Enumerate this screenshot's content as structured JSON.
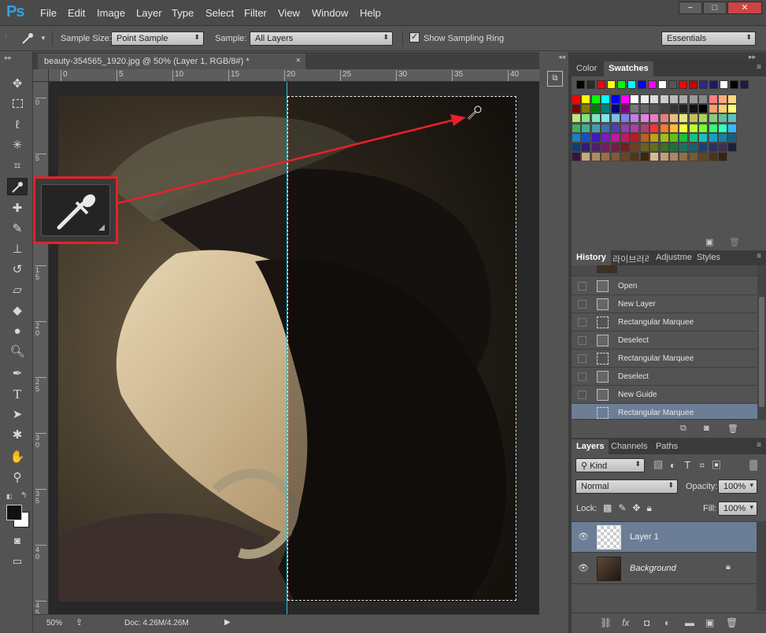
{
  "app": {
    "logo": "Ps"
  },
  "menu": [
    "File",
    "Edit",
    "Image",
    "Layer",
    "Type",
    "Select",
    "Filter",
    "View",
    "Window",
    "Help"
  ],
  "window_controls": {
    "minimize": "−",
    "restore": "□",
    "close": "✕"
  },
  "options": {
    "sample_size_label": "Sample Size:",
    "sample_size_value": "Point Sample",
    "sample_label": "Sample:",
    "sample_value": "All Layers",
    "show_sampling_ring": "Show Sampling Ring",
    "workspace": "Essentials"
  },
  "document": {
    "tab_title": "beauty-354565_1920.jpg @ 50% (Layer 1, RGB/8#) *",
    "close": "×",
    "zoom": "50%",
    "doc_info": "Doc: 4.26M/4.26M"
  },
  "rulers": {
    "top": [
      "0",
      "5",
      "10",
      "15",
      "20",
      "25",
      "30",
      "35",
      "40"
    ],
    "left": [
      "0",
      "5",
      "1\n0",
      "1\n5",
      "2\n0",
      "2\n5",
      "3\n0",
      "3\n5",
      "4\n0",
      "4\n5"
    ]
  },
  "color_panel": {
    "tabs": [
      "Color",
      "Swatches"
    ],
    "active": "Swatches"
  },
  "swatches": {
    "row1": [
      "#000000",
      "#2b2b2b",
      "#ff0000",
      "#ffff00",
      "#00ff00",
      "#00ffff",
      "#0000ff",
      "#ff00ff",
      "#ffffff",
      "#555555",
      "#ff0000",
      "#cc0000",
      "#2b2b80",
      "#1a1a6b",
      "#ffffff",
      "#000000",
      "#1a1a4d"
    ],
    "grid": [
      [
        "#ff0000",
        "#ffff00",
        "#00ff00",
        "#00ffff",
        "#0000ff",
        "#ff00ff",
        "#ffffff",
        "#eeeeee",
        "#dddddd",
        "#cccccc",
        "#bbbbbb",
        "#aaaaaa",
        "#999999",
        "#888888",
        "#ff7f7f",
        "#ffaa7f",
        "#ffd47f"
      ],
      [
        "#7f0000",
        "#7f7f00",
        "#007f00",
        "#007f7f",
        "#00007f",
        "#7f007f",
        "#777777",
        "#666666",
        "#555555",
        "#444444",
        "#333333",
        "#222222",
        "#111111",
        "#000000",
        "#ff9f6f",
        "#ffcf6f",
        "#ffff6f"
      ],
      [
        "#bfe57f",
        "#7fe57f",
        "#7fe5bf",
        "#7fe5e5",
        "#7fbfe5",
        "#7f7fe5",
        "#bf7fe5",
        "#e57fe5",
        "#e57fbf",
        "#e57f7f",
        "#e5bf7f",
        "#e5e57f",
        "#bfbf60",
        "#a5d65a",
        "#7fcf7f",
        "#60bf9f",
        "#5fbfbf"
      ],
      [
        "#3fae5f",
        "#3fae8f",
        "#3f9fae",
        "#3f6fae",
        "#4f3fae",
        "#8f3fae",
        "#ae3f9f",
        "#ae3f6f",
        "#ff3333",
        "#ff7733",
        "#ffbb33",
        "#ffff33",
        "#bbff33",
        "#77ff33",
        "#33ff77",
        "#33ffbb",
        "#33bbff"
      ],
      [
        "#1a7fbf",
        "#1a4fbf",
        "#3f1abf",
        "#7f1abf",
        "#bf1a9f",
        "#bf1a5f",
        "#bf1a1a",
        "#bf5f1a",
        "#bf9f1a",
        "#9fbf1a",
        "#5fbf1a",
        "#1abf3f",
        "#1abf7f",
        "#1abfbf",
        "#1a9fbf",
        "#1a7f9f",
        "#1a5f7f"
      ],
      [
        "#0f3f6f",
        "#2f1f6f",
        "#4f1f6f",
        "#6f1f5f",
        "#6f1f3f",
        "#6f1f1f",
        "#6f3f1f",
        "#6f5f1f",
        "#5f6f1f",
        "#3f6f1f",
        "#1f6f3f",
        "#1f6f5f",
        "#1f5f6f",
        "#1f3f6f",
        "#2f2f5f",
        "#3f2f4f",
        "#1f1f3f"
      ],
      [
        "#3f0f3f",
        "#c8a882",
        "#b08860",
        "#987048",
        "#805a34",
        "#6a4624",
        "#563418",
        "#3f240f",
        "#d8b890",
        "#c0a078",
        "#a88860",
        "#907048",
        "#785a34",
        "#604424",
        "#4a3418",
        "#34240f"
      ]
    ]
  },
  "history_panel": {
    "tabs": [
      "History",
      "라이브러리",
      "Adjustme",
      "Styles"
    ],
    "items": [
      {
        "label": "Open",
        "icon": "doc"
      },
      {
        "label": "New Layer",
        "icon": "doc"
      },
      {
        "label": "Rectangular Marquee",
        "icon": "marquee"
      },
      {
        "label": "Deselect",
        "icon": "doc"
      },
      {
        "label": "Rectangular Marquee",
        "icon": "marquee"
      },
      {
        "label": "Deselect",
        "icon": "doc"
      },
      {
        "label": "New Guide",
        "icon": "doc"
      },
      {
        "label": "Rectangular Marquee",
        "icon": "marquee",
        "selected": true
      }
    ]
  },
  "layers_panel": {
    "tabs": [
      "Layers",
      "Channels",
      "Paths"
    ],
    "kind": "Kind",
    "blend_mode": "Normal",
    "opacity_label": "Opacity:",
    "opacity_value": "100%",
    "lock_label": "Lock:",
    "fill_label": "Fill:",
    "fill_value": "100%",
    "layers": [
      {
        "name": "Layer 1",
        "selected": true
      },
      {
        "name": "Background",
        "locked": true
      }
    ]
  },
  "colors": {
    "accent_red": "#e8202a",
    "guide": "#26c7d9",
    "selection": "#6c7e97"
  }
}
